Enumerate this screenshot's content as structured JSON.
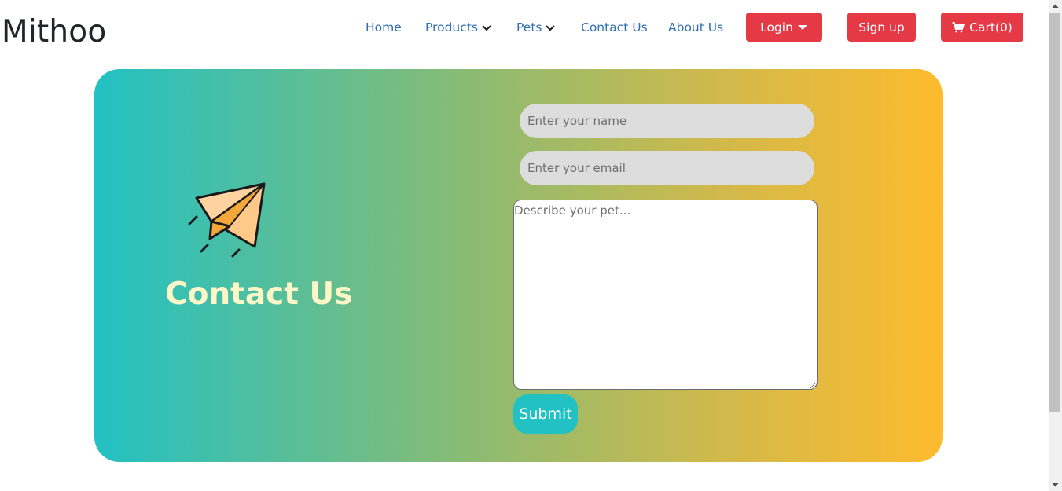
{
  "brand": "Mithoo",
  "nav": {
    "home": "Home",
    "products": "Products",
    "pets": "Pets",
    "contact": "Contact Us",
    "about": "About Us",
    "login": "Login",
    "signup": "Sign up",
    "cart": "Cart(0)"
  },
  "contact": {
    "title": "Contact Us",
    "name_placeholder": "Enter your name",
    "email_placeholder": "Enter your email",
    "message_placeholder": "Describe your pet...",
    "submit_label": "Submit"
  },
  "icons": {
    "hero": "paper-plane-icon",
    "cart": "cart-icon",
    "dropdown": "chevron-down-icon",
    "caret": "caret-down-icon"
  },
  "colors": {
    "brand_red": "#e63946",
    "link_blue": "#2f6db5",
    "gradient_start": "#22c1c3",
    "gradient_end": "#fdbb2d",
    "title_text": "#fdf7c8"
  }
}
